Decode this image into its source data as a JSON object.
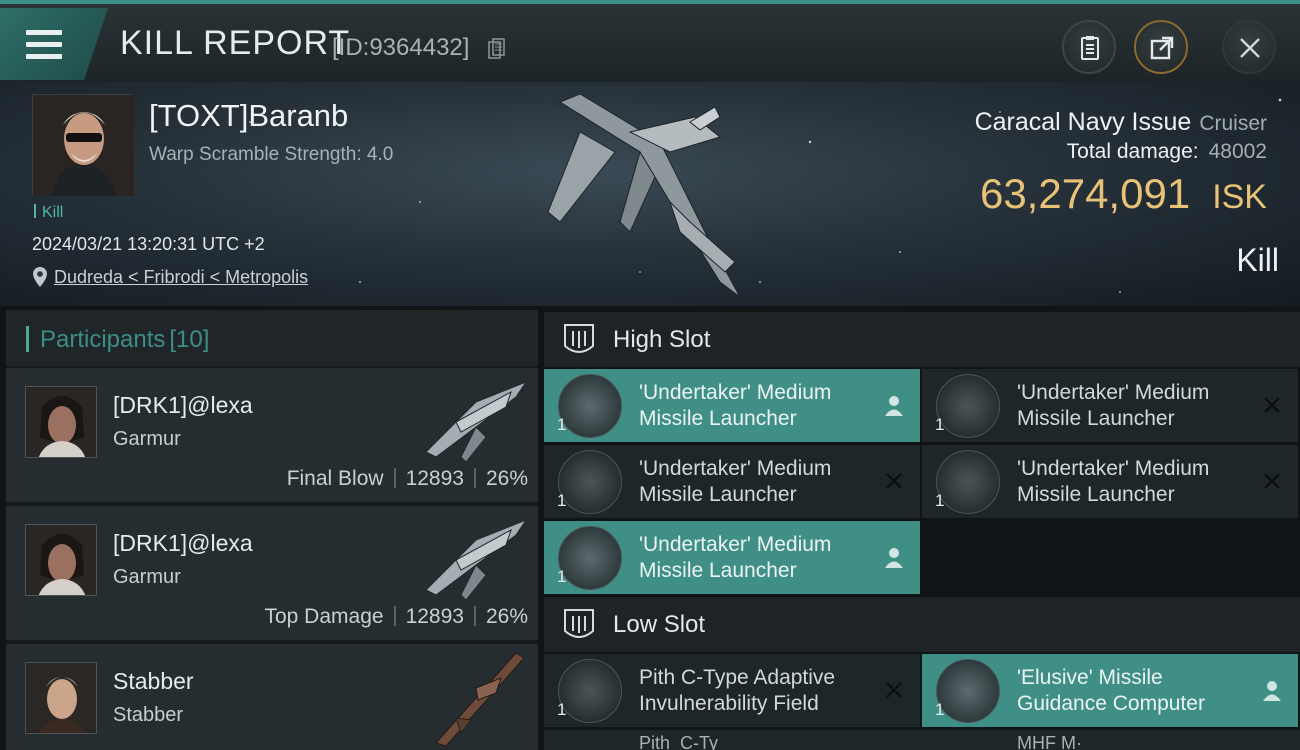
{
  "header": {
    "title": "KILL REPORT",
    "report_id": "[ID:9364432]"
  },
  "victim": {
    "name": "[TOXT]Baranb",
    "warp_scramble": "Warp Scramble Strength: 4.0",
    "tag": "Kill",
    "datetime": "2024/03/21 13:20:31 UTC +2",
    "location": "Dudreda < Fribrodi < Metropolis",
    "ship": "Caracal Navy Issue",
    "ship_class": "Cruiser",
    "total_damage_label": "Total damage:",
    "total_damage": "48002",
    "isk_value": "63,274,091",
    "isk_unit": "ISK",
    "result": "Kill"
  },
  "participants": {
    "label": "Participants",
    "count": "[10]",
    "rows": [
      {
        "name": "[DRK1]@lexa",
        "ship": "Garmur",
        "role": "Final Blow",
        "damage": "12893",
        "percent": "26%"
      },
      {
        "name": "[DRK1]@lexa",
        "ship": "Garmur",
        "role": "Top Damage",
        "damage": "12893",
        "percent": "26%"
      },
      {
        "name": "Stabber",
        "ship": "Stabber"
      }
    ]
  },
  "fitting": {
    "high_slot": {
      "label": "High Slot",
      "modules": [
        {
          "line1": "'Undertaker' Medium",
          "line2": "Missile Launcher",
          "qty": "1",
          "state": "dropped"
        },
        {
          "line1": "'Undertaker' Medium",
          "line2": "Missile Launcher",
          "qty": "1",
          "state": "destroyed"
        },
        {
          "line1": "'Undertaker' Medium",
          "line2": "Missile Launcher",
          "qty": "1",
          "state": "destroyed"
        },
        {
          "line1": "'Undertaker' Medium",
          "line2": "Missile Launcher",
          "qty": "1",
          "state": "destroyed"
        },
        {
          "line1": "'Undertaker' Medium",
          "line2": "Missile Launcher",
          "qty": "1",
          "state": "dropped"
        }
      ]
    },
    "low_slot": {
      "label": "Low Slot",
      "modules": [
        {
          "line1": "Pith C-Type Adaptive",
          "line2": "Invulnerability Field",
          "qty": "1",
          "state": "destroyed"
        },
        {
          "line1": "'Elusive' Missile",
          "line2": "Guidance Computer",
          "qty": "1",
          "state": "dropped"
        }
      ],
      "partial": [
        "Pith  C-Ty",
        "MHF M·"
      ]
    }
  },
  "colors": {
    "accent": "#3f8f86",
    "isk": "#e7c277",
    "kill_tag": "#52b5a6"
  }
}
